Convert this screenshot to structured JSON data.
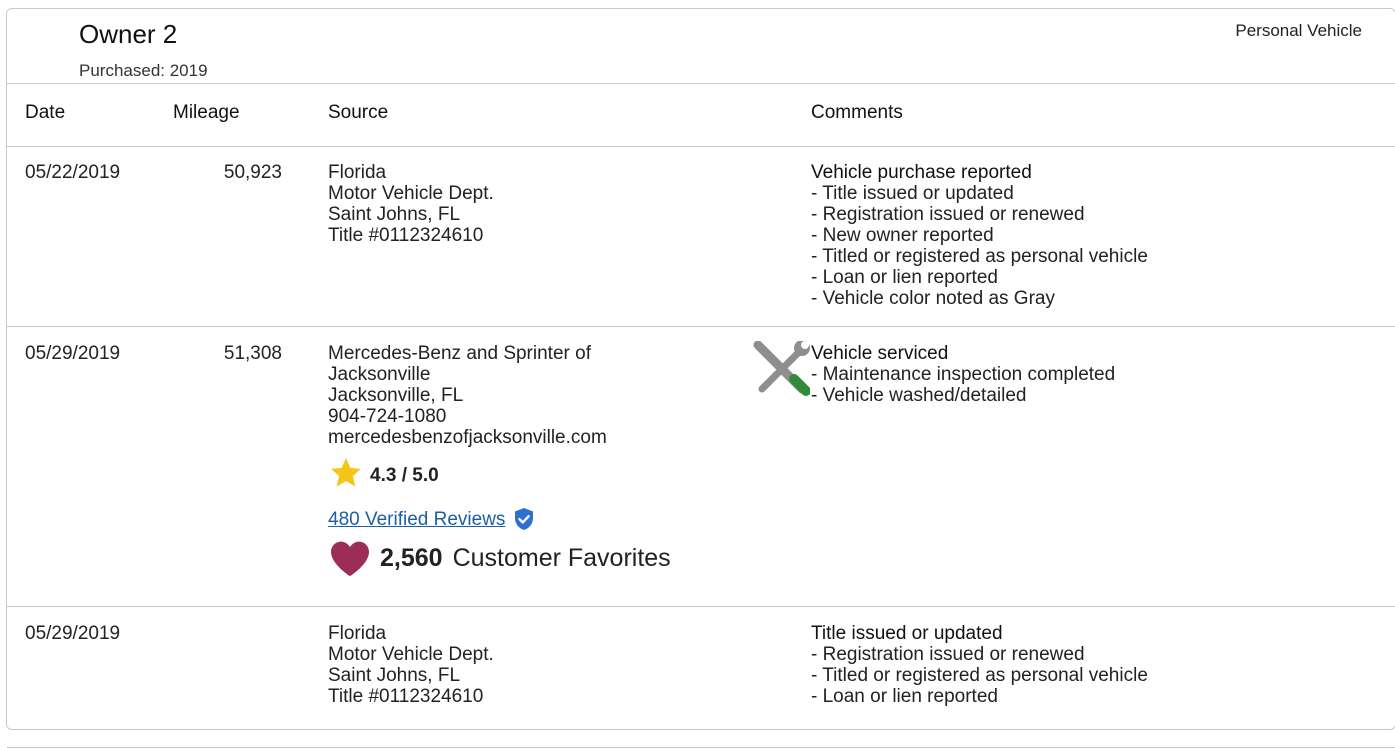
{
  "owner": {
    "title": "Owner 2",
    "purchased": "Purchased: 2019",
    "vehicle_type": "Personal Vehicle"
  },
  "columns": {
    "date": "Date",
    "mileage": "Mileage",
    "source": "Source",
    "comments": "Comments"
  },
  "rows": [
    {
      "date": "05/22/2019",
      "mileage": "50,923",
      "source": [
        "Florida",
        "Motor Vehicle Dept.",
        "Saint Johns, FL",
        "Title #0112324610"
      ],
      "comment_title": "Vehicle purchase reported",
      "comments": [
        "- Title issued or updated",
        "- Registration issued or renewed",
        "- New owner reported",
        "- Titled or registered as personal vehicle",
        "- Loan or lien reported",
        "- Vehicle color noted as Gray"
      ]
    },
    {
      "date": "05/29/2019",
      "mileage": "51,308",
      "source": [
        "Mercedes-Benz and Sprinter of",
        "Jacksonville",
        "Jacksonville, FL",
        "904-724-1080",
        "mercedesbenzofjacksonville.com"
      ],
      "rating": "4.3 / 5.0",
      "reviews_link": "480 Verified Reviews",
      "favorites_count": "2,560",
      "favorites_label": "Customer Favorites",
      "comment_title": "Vehicle serviced",
      "comments": [
        "- Maintenance inspection completed",
        "- Vehicle washed/detailed"
      ],
      "icon": "wrench-screwdriver-icon"
    },
    {
      "date": "05/29/2019",
      "mileage": "",
      "source": [
        "Florida",
        "Motor Vehicle Dept.",
        "Saint Johns, FL",
        "Title #0112324610"
      ],
      "comment_title": "Title issued or updated",
      "comments": [
        "- Registration issued or renewed",
        "- Titled or registered as personal vehicle",
        "- Loan or lien reported"
      ]
    }
  ],
  "colors": {
    "link": "#1d5fa3",
    "star": "#f5c518",
    "heart": "#9b2d57",
    "verified": "#2f6fd1",
    "border": "#c9c9c9"
  }
}
